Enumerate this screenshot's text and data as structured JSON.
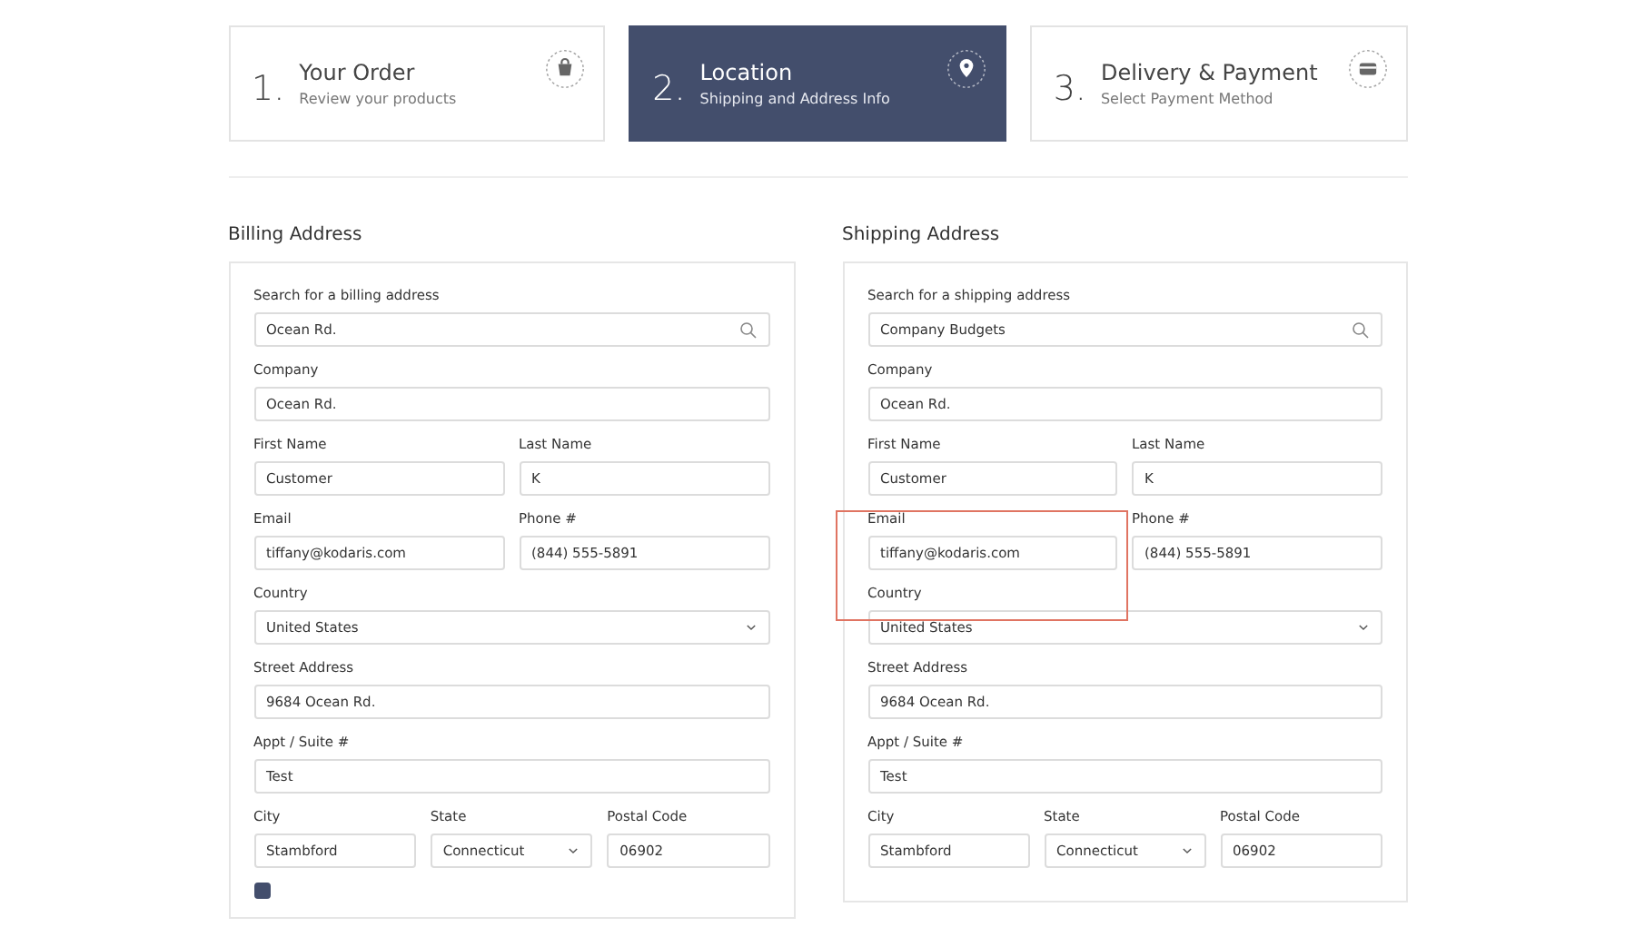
{
  "steps": [
    {
      "number": "1.",
      "title": "Your Order",
      "subtitle": "Review your products",
      "selected": false
    },
    {
      "number": "2.",
      "title": "Location",
      "subtitle": "Shipping and Address Info",
      "selected": true
    },
    {
      "number": "3.",
      "title": "Delivery & Payment",
      "subtitle": "Select Payment Method",
      "selected": false
    }
  ],
  "billing": {
    "title": "Billing Address",
    "same_as_billing_checked": true,
    "rows": [
      [
        {
          "label": "Search for a billing address",
          "value": "Ocean Rd.",
          "kind": "search"
        }
      ],
      [
        {
          "label": "Company",
          "value": "Ocean Rd.",
          "kind": "text"
        }
      ],
      [
        {
          "label": "First Name",
          "value": "Customer",
          "kind": "text"
        },
        {
          "label": "Last Name",
          "value": "K",
          "kind": "text"
        }
      ],
      [
        {
          "label": "Email",
          "value": "tiffany@kodaris.com",
          "kind": "text"
        },
        {
          "label": "Phone #",
          "value": "(844) 555-5891",
          "kind": "text"
        }
      ],
      [
        {
          "label": "Country",
          "value": "United States",
          "kind": "select"
        }
      ],
      [
        {
          "label": "Street Address",
          "value": "9684 Ocean Rd.",
          "kind": "text"
        }
      ],
      [
        {
          "label": "Appt / Suite #",
          "value": "Test",
          "kind": "text"
        }
      ],
      [
        {
          "label": "City",
          "value": "Stambford",
          "kind": "text"
        },
        {
          "label": "State",
          "value": "Connecticut",
          "kind": "select"
        },
        {
          "label": "Postal Code",
          "value": "06902",
          "kind": "text"
        }
      ]
    ]
  },
  "shipping": {
    "title": "Shipping Address",
    "highlight_email": true,
    "rows": [
      [
        {
          "label": "Search for a shipping address",
          "value": "Company Budgets",
          "kind": "search"
        }
      ],
      [
        {
          "label": "Company",
          "value": "Ocean Rd.",
          "kind": "text"
        }
      ],
      [
        {
          "label": "First Name",
          "value": "Customer",
          "kind": "text"
        },
        {
          "label": "Last Name",
          "value": "K",
          "kind": "text"
        }
      ],
      [
        {
          "label": "Email",
          "value": "tiffany@kodaris.com",
          "kind": "text"
        },
        {
          "label": "Phone #",
          "value": "(844) 555-5891",
          "kind": "text"
        }
      ],
      [
        {
          "label": "Country",
          "value": "United States",
          "kind": "select"
        }
      ],
      [
        {
          "label": "Street Address",
          "value": "9684 Ocean Rd.",
          "kind": "text"
        }
      ],
      [
        {
          "label": "Appt / Suite #",
          "value": "Test",
          "kind": "text"
        }
      ],
      [
        {
          "label": "City",
          "value": "Stambford",
          "kind": "text"
        },
        {
          "label": "State",
          "value": "Connecticut",
          "kind": "select"
        },
        {
          "label": "Postal Code",
          "value": "06902",
          "kind": "text"
        }
      ]
    ]
  }
}
